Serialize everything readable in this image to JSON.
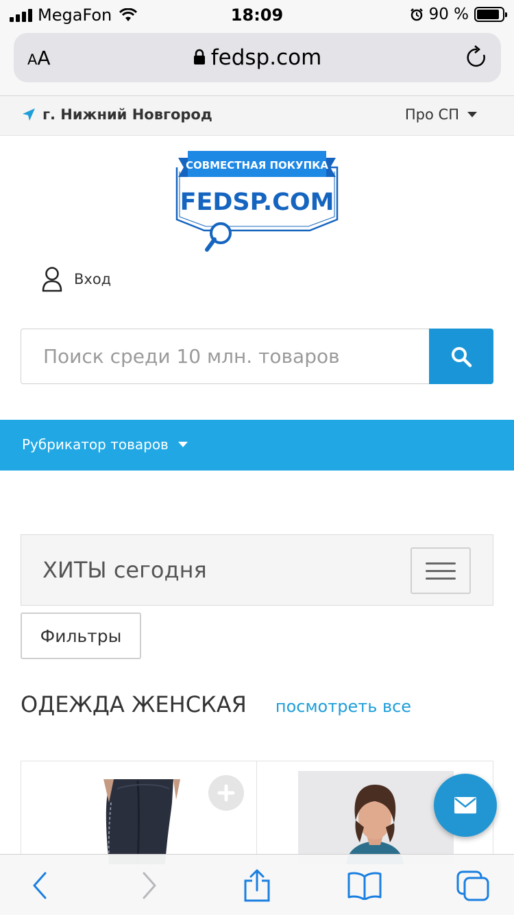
{
  "status_bar": {
    "carrier": "MegaFon",
    "time": "18:09",
    "battery_text": "90 %",
    "battery_level": 0.9
  },
  "browser": {
    "text_size_button": "AA",
    "url": "fedsp.com"
  },
  "location_bar": {
    "city": "г. Нижний Новгород",
    "about_menu": "Про СП"
  },
  "logo": {
    "banner_text": "СОВМЕСТНАЯ ПОКУПКА",
    "brand_text": "FEDSP.COM"
  },
  "login": {
    "label": "Вход"
  },
  "search": {
    "placeholder": "Поиск среди 10 млн. товаров"
  },
  "category_menu": {
    "label": "Рубрикатор товаров"
  },
  "hits": {
    "title": "ХИТЫ сегодня"
  },
  "filters": {
    "label": "Фильтры"
  },
  "section": {
    "title": "ОДЕЖДА ЖЕНСКАЯ",
    "view_all": "посмотреть все"
  },
  "colors": {
    "accent": "#21a8e4",
    "search_button": "#1a96d8",
    "link": "#1e9ed9",
    "brand_blue": "#1565c0"
  },
  "icons": {
    "location": "location-arrow-icon",
    "user": "user-icon",
    "search": "search-icon",
    "menu": "hamburger-icon",
    "add": "plus-icon",
    "mail": "envelope-icon"
  }
}
